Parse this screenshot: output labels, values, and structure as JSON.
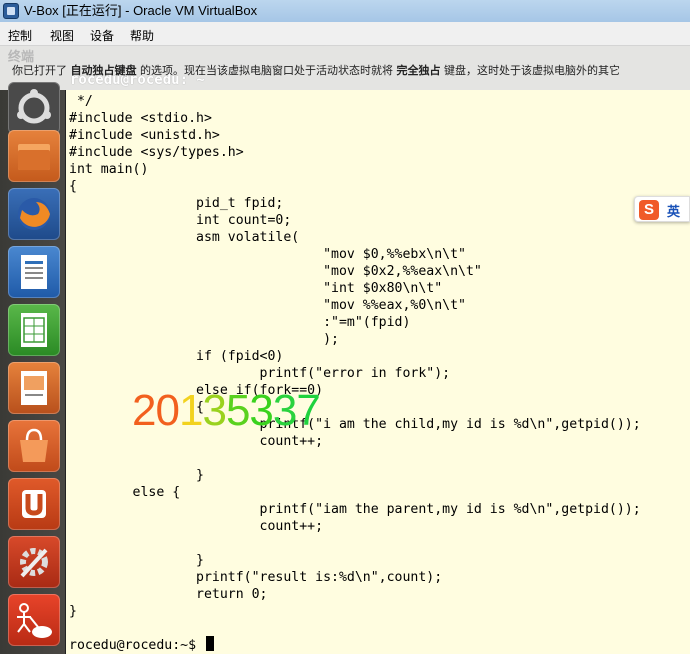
{
  "window": {
    "title": "V-Box [正在运行] - Oracle VM VirtualBox",
    "icon": "virtualbox-icon"
  },
  "menubar": {
    "items": [
      "控制",
      "视图",
      "设备",
      "帮助"
    ]
  },
  "notification": {
    "ghost_title": "终端",
    "text_before": "你已打开了",
    "bold1": "自动独占键盘",
    "text_mid": "的选项。现在当该虚拟电脑窗口处于活动状态时就将",
    "bold2": "完全独占",
    "text_after": "键盘，这时处于该虚拟电脑外的其它",
    "ghost_prompt": "rocedu@rocedu: ~"
  },
  "launcher": {
    "items": [
      {
        "name": "ubuntu-dash-icon",
        "bg": "#4a4a4a"
      },
      {
        "name": "files-icon",
        "bg": "#d96a2c"
      },
      {
        "name": "firefox-icon",
        "bg": "#cf5f1e"
      },
      {
        "name": "libreoffice-writer-icon",
        "bg": "#2f6fb8"
      },
      {
        "name": "libreoffice-calc-icon",
        "bg": "#3a9a34"
      },
      {
        "name": "libreoffice-impress-icon",
        "bg": "#c8641e"
      },
      {
        "name": "software-center-icon",
        "bg": "#cf5f1e"
      },
      {
        "name": "ubuntu-one-icon",
        "bg": "#c84a1c"
      },
      {
        "name": "system-settings-icon",
        "bg": "#c83a22"
      },
      {
        "name": "umbrello-icon",
        "bg": "#d33520"
      }
    ]
  },
  "terminal": {
    "lines": [
      " */",
      "#include <stdio.h>",
      "#include <unistd.h>",
      "#include <sys/types.h>",
      "int main()",
      "{",
      "                pid_t fpid;",
      "                int count=0;",
      "                asm volatile(",
      "                                \"mov $0,%%ebx\\n\\t\"",
      "                                \"mov $0x2,%%eax\\n\\t\"",
      "                                \"int $0x80\\n\\t\"",
      "                                \"mov %%eax,%0\\n\\t\"",
      "                                :\"=m\"(fpid)",
      "                                );",
      "                if (fpid<0)",
      "                        printf(\"error in fork\");",
      "                else if(fork==0)",
      "                {",
      "                        printf(\"i am the child,my id is %d\\n\",getpid());",
      "                        count++;",
      "",
      "                }",
      "        else {",
      "                        printf(\"iam the parent,my id is %d\\n\",getpid());",
      "                        count++;",
      "",
      "                }",
      "                printf(\"result is:%d\\n\",count);",
      "                return 0;",
      "}"
    ],
    "prompt": "rocedu@rocedu:~$ "
  },
  "watermark": {
    "digits": [
      {
        "ch": "2",
        "color": "#f2601e"
      },
      {
        "ch": "0",
        "color": "#f2601e"
      },
      {
        "ch": "1",
        "color": "#f2d21e"
      },
      {
        "ch": "3",
        "color": "#9ad21e"
      },
      {
        "ch": "5",
        "color": "#5ad21e"
      },
      {
        "ch": "3",
        "color": "#3ad21e"
      },
      {
        "ch": "3",
        "color": "#2ad23e"
      },
      {
        "ch": "7",
        "color": "#1ed23e"
      }
    ]
  },
  "ime": {
    "logo": "S",
    "lang": "英"
  }
}
